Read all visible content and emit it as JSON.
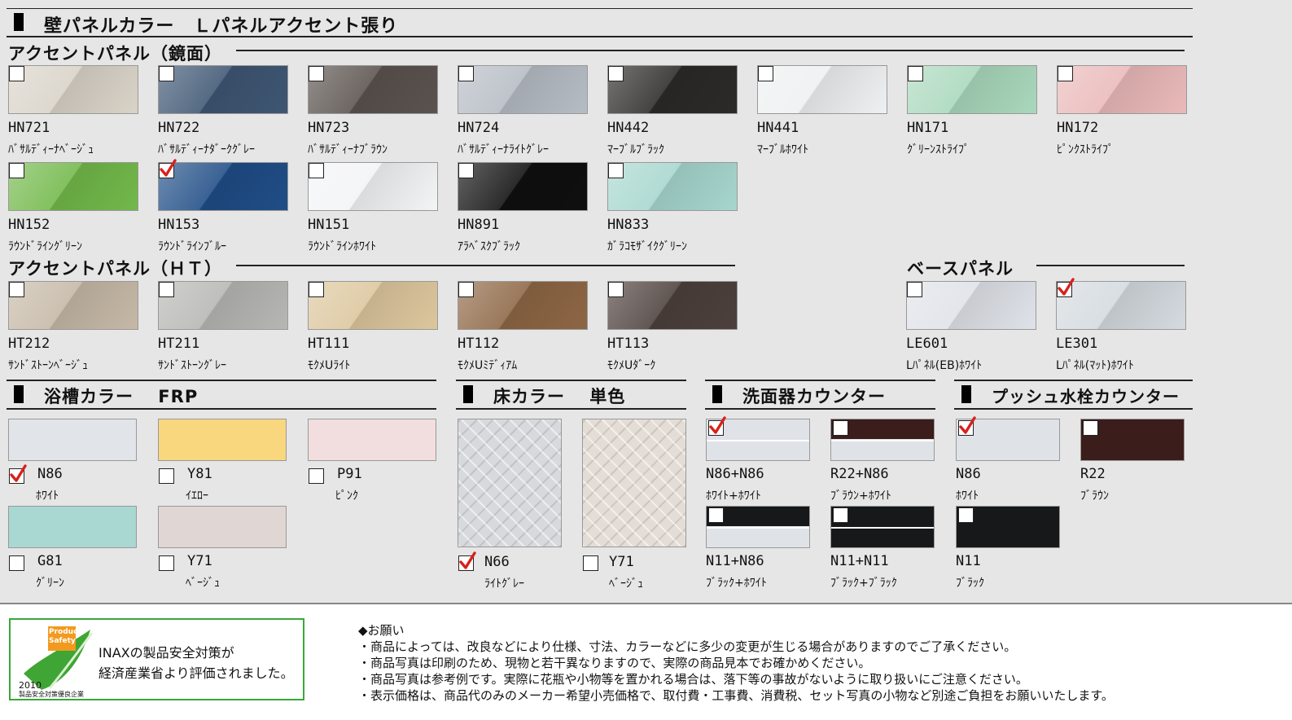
{
  "main_title": "壁パネルカラー　Ｌパネルアクセント張り",
  "accent_mirror": {
    "title": "アクセントパネル（鏡面）",
    "items": [
      {
        "code": "HN721",
        "name": "ﾊﾞｻﾙﾃﾞｨｰﾅﾍﾞｰｼﾞｭ",
        "color": "#d9d3c8",
        "checked": false
      },
      {
        "code": "HN722",
        "name": "ﾊﾞｻﾙﾃﾞｨｰﾅﾀﾞｰｸｸﾞﾚｰ",
        "color": "#3e5673",
        "checked": false
      },
      {
        "code": "HN723",
        "name": "ﾊﾞｻﾙﾃﾞｨｰﾅﾌﾞﾗｳﾝ",
        "color": "#5a524e",
        "checked": false
      },
      {
        "code": "HN724",
        "name": "ﾊﾞｻﾙﾃﾞｨｰﾅﾗｲﾄｸﾞﾚｰ",
        "color": "#b6bcc4",
        "checked": false
      },
      {
        "code": "HN442",
        "name": "ﾏｰﾌﾞﾙﾌﾞﾗｯｸ",
        "color": "#2b2a28",
        "checked": false
      },
      {
        "code": "HN441",
        "name": "ﾏｰﾌﾞﾙﾎﾜｲﾄ",
        "color": "#eef0f1",
        "checked": false
      },
      {
        "code": "HN171",
        "name": "ｸﾞﾘｰﾝｽﾄﾗｲﾌﾟ",
        "color": "#a9d8bc",
        "checked": false
      },
      {
        "code": "HN172",
        "name": "ﾋﾟﾝｸｽﾄﾗｲﾌﾟ",
        "color": "#eab9b9",
        "checked": false
      },
      {
        "code": "HN152",
        "name": "ﾗｳﾝﾄﾞﾗｲﾝｸﾞﾘｰﾝ",
        "color": "#72b84a",
        "checked": false
      },
      {
        "code": "HN153",
        "name": "ﾗｳﾝﾄﾞﾗｲﾝﾌﾞﾙｰ",
        "color": "#1f4d86",
        "checked": true
      },
      {
        "code": "HN151",
        "name": "ﾗｳﾝﾄﾞﾗｲﾝﾎﾜｲﾄ",
        "color": "#f3f4f6",
        "checked": false
      },
      {
        "code": "HN891",
        "name": "ｱﾗﾍﾞｽｸﾌﾞﾗｯｸ",
        "color": "#0f0f10",
        "checked": false
      },
      {
        "code": "HN833",
        "name": "ｶﾞﾗｺﾓｻﾞｲｸｸﾞﾘｰﾝ",
        "color": "#a6d6ce",
        "checked": false
      }
    ]
  },
  "accent_ht": {
    "title": "アクセントパネル（ＨＴ）",
    "items": [
      {
        "code": "HT212",
        "name": "ｻﾝﾄﾞｽﾄｰﾝﾍﾞｰｼﾞｭ",
        "color": "#c5b8a6",
        "checked": false
      },
      {
        "code": "HT211",
        "name": "ｻﾝﾄﾞｽﾄｰﾝｸﾞﾚｰ",
        "color": "#b6b6b4",
        "checked": false
      },
      {
        "code": "HT111",
        "name": "ﾓｸﾒUﾗｲﾄ",
        "color": "#dcc69d",
        "checked": false
      },
      {
        "code": "HT112",
        "name": "ﾓｸﾒUﾐﾃﾞｨｱﾑ",
        "color": "#8d6644",
        "checked": false
      },
      {
        "code": "HT113",
        "name": "ﾓｸﾒUﾀﾞｰｸ",
        "color": "#4c403c",
        "checked": false
      }
    ]
  },
  "base_panel": {
    "title": "ベースパネル",
    "items": [
      {
        "code": "LE601",
        "name": "Lﾊﾟﾈﾙ(EB)ﾎﾜｲﾄ",
        "color": "#dfe2e8",
        "checked": false
      },
      {
        "code": "LE301",
        "name": "Lﾊﾟﾈﾙ(ﾏｯﾄ)ﾎﾜｲﾄ",
        "color": "#d4dadf",
        "checked": true
      }
    ]
  },
  "bathtub": {
    "title": "浴槽カラー　 FRP",
    "items": [
      {
        "code": "N86",
        "name": "ﾎﾜｲﾄ",
        "color": "#e1e4e8",
        "checked": true
      },
      {
        "code": "Y81",
        "name": "ｲｴﾛｰ",
        "color": "#f8d77f",
        "checked": false
      },
      {
        "code": "P91",
        "name": "ﾋﾟﾝｸ",
        "color": "#f2dede",
        "checked": false
      },
      {
        "code": "G81",
        "name": "ｸﾞﾘｰﾝ",
        "color": "#a9d8d3",
        "checked": false
      },
      {
        "code": "Y71",
        "name": "ﾍﾞｰｼﾞｭ",
        "color": "#e0d6d3",
        "checked": false
      }
    ]
  },
  "floor": {
    "title": "床カラー　 単色",
    "items": [
      {
        "code": "N66",
        "name": "ﾗｲﾄｸﾞﾚｰ",
        "color": "#d7d9dd",
        "checked": true
      },
      {
        "code": "Y71",
        "name": "ﾍﾞｰｼﾞｭ",
        "color": "#e4ddd6",
        "checked": false
      }
    ]
  },
  "basin_counter": {
    "title": "洗面器カウンター",
    "items": [
      {
        "code": "N86+N86",
        "name": "ﾎﾜｲﾄ+ﾎﾜｲﾄ",
        "top": "#dfe3e8",
        "bottom": "#dfe3e8",
        "checked": true
      },
      {
        "code": "R22+N86",
        "name": "ﾌﾞﾗｳﾝ+ﾎﾜｲﾄ",
        "top": "#3b1d1c",
        "bottom": "#dfe3e8",
        "checked": false
      },
      {
        "code": "N11+N86",
        "name": "ﾌﾞﾗｯｸ+ﾎﾜｲﾄ",
        "top": "#161819",
        "bottom": "#dfe3e8",
        "checked": false
      },
      {
        "code": "N11+N11",
        "name": "ﾌﾞﾗｯｸ+ﾌﾞﾗｯｸ",
        "top": "#161819",
        "bottom": "#161819",
        "checked": false
      }
    ]
  },
  "push_counter": {
    "title": "プッシュ水栓カウンター",
    "items": [
      {
        "code": "N86",
        "name": "ﾎﾜｲﾄ",
        "color": "#dfe3e8",
        "checked": true
      },
      {
        "code": "R22",
        "name": "ﾌﾞﾗｳﾝ",
        "color": "#3b1d1c",
        "checked": false
      },
      {
        "code": "N11",
        "name": "ﾌﾞﾗｯｸ",
        "color": "#161819",
        "checked": false
      }
    ]
  },
  "footer": {
    "badge_line1": "Product",
    "badge_line2": "Safety",
    "year": "2010",
    "badge_caption": "製品安全対策優良企業",
    "safety_line1": "INAXの製品安全対策が",
    "safety_line2": "経済産業省より評価されました。",
    "notes_heading": "◆お願い",
    "notes": [
      "・商品によっては、改良などにより仕様、寸法、カラーなどに多少の変更が生じる場合がありますのでご了承ください。",
      "・商品写真は印刷のため、現物と若干異なりますので、実際の商品見本でお確かめください。",
      "・商品写真は参考例です。実際に花瓶や小物等を置かれる場合は、落下等の事故がないように取り扱いにご注意ください。",
      "・表示価格は、商品代のみのメーカー希望小売価格で、取付費・工事費、消費税、セット写真の小物など別途ご負担をお願いいたします。"
    ]
  },
  "colors": {
    "check_mark": "#d8211b",
    "footer_border": "#3aa83a",
    "badge_green": "#3fa535"
  }
}
